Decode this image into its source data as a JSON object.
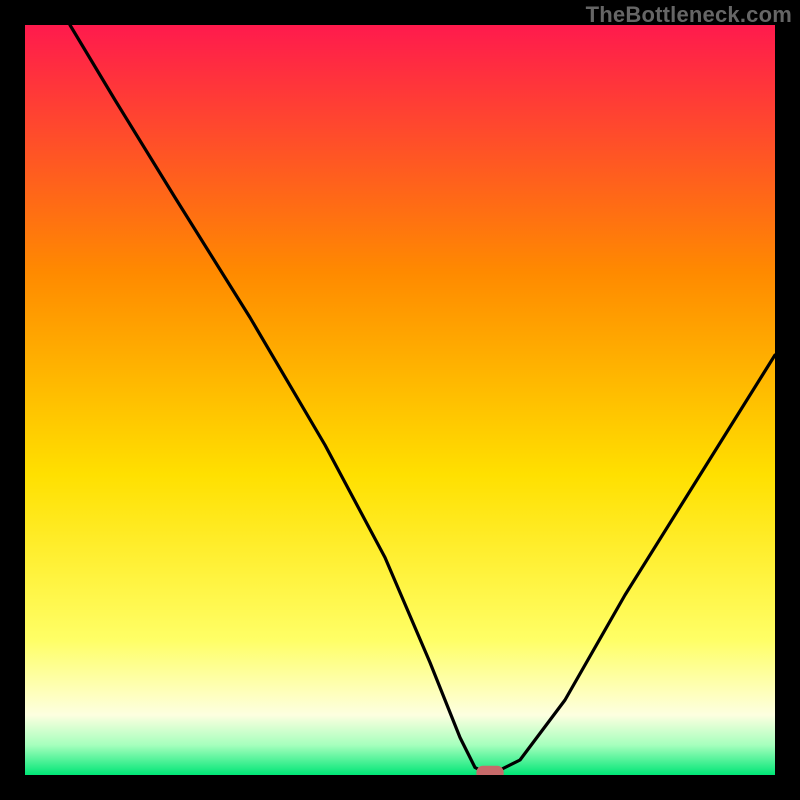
{
  "watermark": "TheBottleneck.com",
  "chart_data": {
    "type": "line",
    "title": "",
    "xlabel": "",
    "ylabel": "",
    "xlim": [
      0,
      100
    ],
    "ylim": [
      0,
      100
    ],
    "gradient_bands": [
      {
        "pos": 0.0,
        "color": "#ff1a4d"
      },
      {
        "pos": 0.33,
        "color": "#ff8a00"
      },
      {
        "pos": 0.6,
        "color": "#ffe000"
      },
      {
        "pos": 0.82,
        "color": "#ffff66"
      },
      {
        "pos": 0.92,
        "color": "#fdffe0"
      },
      {
        "pos": 0.96,
        "color": "#a6ffbd"
      },
      {
        "pos": 1.0,
        "color": "#00e676"
      }
    ],
    "series": [
      {
        "name": "bottleneck-curve",
        "x": [
          6,
          12,
          20,
          30,
          40,
          48,
          54,
          58,
          60,
          62,
          66,
          72,
          80,
          90,
          100
        ],
        "y": [
          100,
          90,
          77,
          61,
          44,
          29,
          15,
          5,
          1,
          0,
          2,
          10,
          24,
          40,
          56
        ]
      }
    ],
    "marker": {
      "x": 62,
      "y": 0,
      "w": 3.5,
      "h": 1.8
    }
  }
}
